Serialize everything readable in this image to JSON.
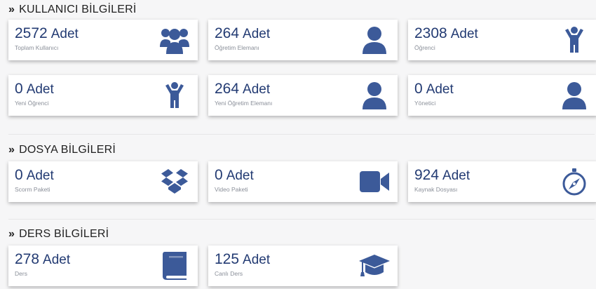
{
  "unit": "Adet",
  "sections": {
    "users": {
      "title": "KULLANICI BİLGİLERİ",
      "cards": [
        {
          "value": "2572",
          "label": "Toplam Kullanıcı",
          "icon": "users-icon"
        },
        {
          "value": "264",
          "label": "Öğretim Elemanı",
          "icon": "user-icon"
        },
        {
          "value": "2308",
          "label": "Öğrenci",
          "icon": "child-icon"
        },
        {
          "value": "0",
          "label": "Yeni Öğrenci",
          "icon": "child-icon"
        },
        {
          "value": "264",
          "label": "Yeni Öğretim Elemanı",
          "icon": "user-icon"
        },
        {
          "value": "0",
          "label": "Yönetici",
          "icon": "user-icon"
        }
      ]
    },
    "files": {
      "title": "DOSYA BİLGİLERİ",
      "cards": [
        {
          "value": "0",
          "label": "Scorm Paketi",
          "icon": "dropbox-icon"
        },
        {
          "value": "0",
          "label": "Video Paketi",
          "icon": "video-camera-icon"
        },
        {
          "value": "924",
          "label": "Kaynak Dosyası",
          "icon": "compass-icon"
        }
      ]
    },
    "courses": {
      "title": "DERS BİLGİLERİ",
      "cards": [
        {
          "value": "278",
          "label": "Ders",
          "icon": "book-icon"
        },
        {
          "value": "125",
          "label": "Canlı Ders",
          "icon": "graduation-cap-icon"
        }
      ]
    }
  },
  "colors": {
    "accent": "#3c5a99",
    "value_text": "#233b73",
    "label_text": "#8a8f99"
  }
}
